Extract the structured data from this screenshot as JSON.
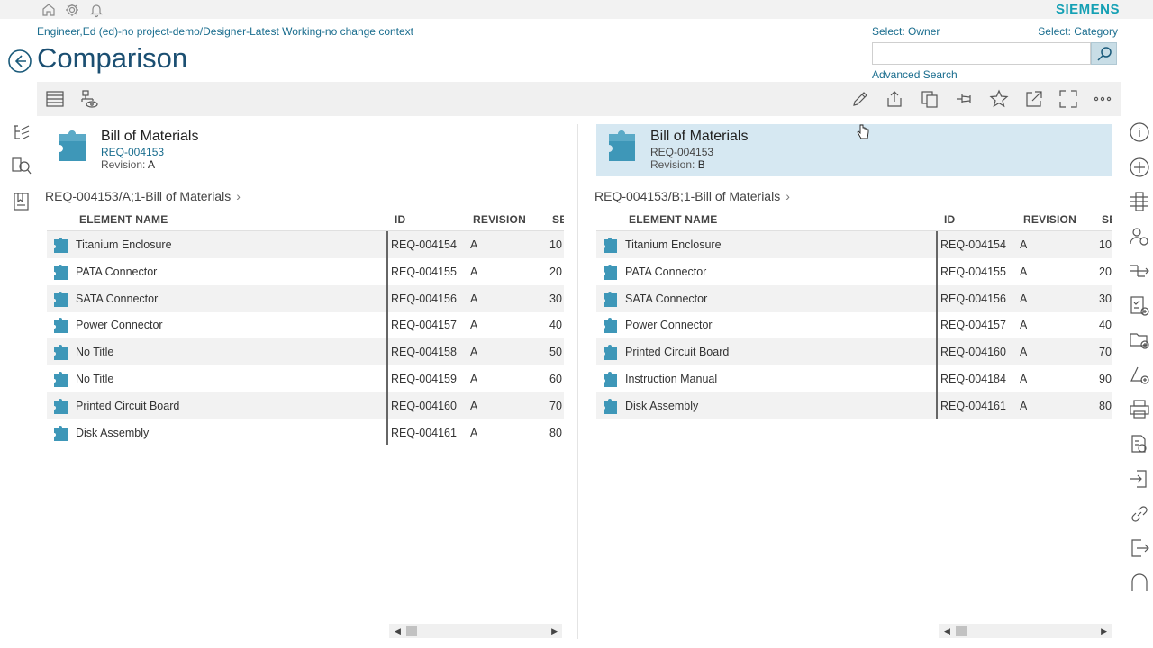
{
  "brand": "SIEMENS",
  "context_path": "Engineer,Ed (ed)-no project-demo/Designer-Latest Working-no change context",
  "page_title": "Comparison",
  "search": {
    "owner_label": "Select: Owner",
    "category_label": "Select: Category",
    "placeholder": "",
    "advanced_label": "Advanced Search"
  },
  "left": {
    "header": {
      "name": "Bill of Materials",
      "id": "REQ-004153",
      "revision_label": "Revision:",
      "revision": "A"
    },
    "breadcrumb": "REQ-004153/A;1-Bill of Materials",
    "columns": [
      "ELEMENT NAME",
      "ID",
      "REVISION",
      "SE"
    ],
    "rows": [
      {
        "name": "Titanium Enclosure",
        "id": "REQ-004154",
        "rev": "A",
        "seq": "10"
      },
      {
        "name": "PATA Connector",
        "id": "REQ-004155",
        "rev": "A",
        "seq": "20"
      },
      {
        "name": "SATA Connector",
        "id": "REQ-004156",
        "rev": "A",
        "seq": "30"
      },
      {
        "name": "Power Connector",
        "id": "REQ-004157",
        "rev": "A",
        "seq": "40"
      },
      {
        "name": "No Title",
        "id": "REQ-004158",
        "rev": "A",
        "seq": "50"
      },
      {
        "name": "No Title",
        "id": "REQ-004159",
        "rev": "A",
        "seq": "60"
      },
      {
        "name": "Printed Circuit Board",
        "id": "REQ-004160",
        "rev": "A",
        "seq": "70"
      },
      {
        "name": "Disk Assembly",
        "id": "REQ-004161",
        "rev": "A",
        "seq": "80"
      }
    ]
  },
  "right": {
    "header": {
      "name": "Bill of Materials",
      "id": "REQ-004153",
      "revision_label": "Revision:",
      "revision": "B"
    },
    "breadcrumb": "REQ-004153/B;1-Bill of Materials",
    "columns": [
      "ELEMENT NAME",
      "ID",
      "REVISION",
      "SE"
    ],
    "rows": [
      {
        "name": "Titanium Enclosure",
        "id": "REQ-004154",
        "rev": "A",
        "seq": "10"
      },
      {
        "name": "PATA Connector",
        "id": "REQ-004155",
        "rev": "A",
        "seq": "20"
      },
      {
        "name": "SATA Connector",
        "id": "REQ-004156",
        "rev": "A",
        "seq": "30"
      },
      {
        "name": "Power Connector",
        "id": "REQ-004157",
        "rev": "A",
        "seq": "40"
      },
      {
        "name": "Printed Circuit Board",
        "id": "REQ-004160",
        "rev": "A",
        "seq": "70"
      },
      {
        "name": "Instruction Manual",
        "id": "REQ-004184",
        "rev": "A",
        "seq": "90"
      },
      {
        "name": "Disk Assembly",
        "id": "REQ-004161",
        "rev": "A",
        "seq": "80"
      }
    ]
  },
  "colors": {
    "accent": "#1b4f72",
    "link": "#1a6d8e",
    "brand": "#14a0b4",
    "selected_bg": "#d6e8f2",
    "puzzle": "#2f8fb0"
  }
}
